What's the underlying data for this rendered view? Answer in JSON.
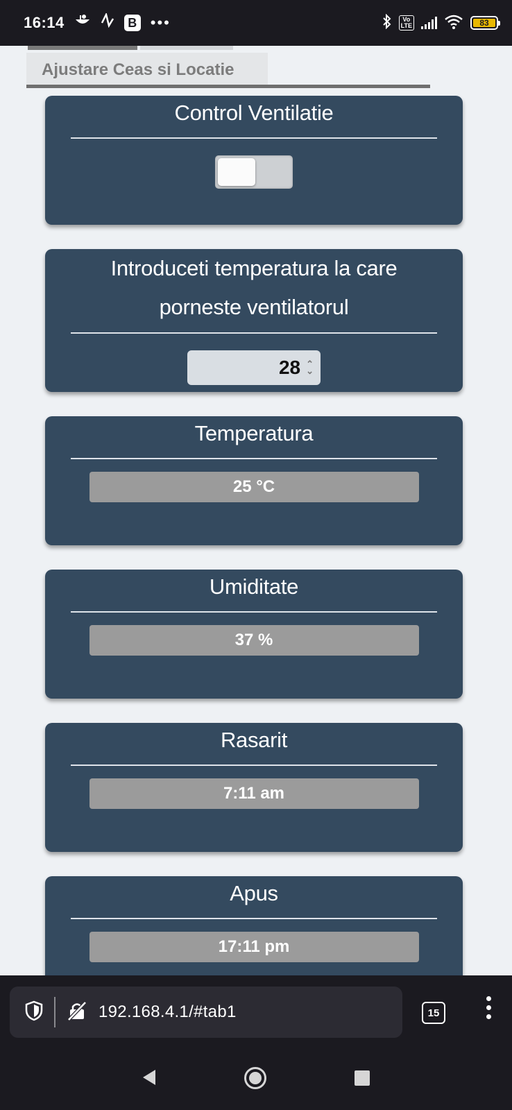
{
  "status_bar": {
    "time": "16:14",
    "battery": "83"
  },
  "tab": {
    "label": "Ajustare Ceas si Locatie"
  },
  "cards": {
    "ventilation": {
      "title": "Control Ventilatie",
      "toggle_state": "off"
    },
    "threshold": {
      "title": "Introduceti temperatura la care porneste ventilatorul",
      "value": "28"
    },
    "temperature": {
      "title": "Temperatura",
      "value": "25 °C"
    },
    "humidity": {
      "title": "Umiditate",
      "value": "37 %"
    },
    "sunrise": {
      "title": "Rasarit",
      "value": "7:11 am"
    },
    "sunset": {
      "title": "Apus",
      "value": "17:11 pm"
    }
  },
  "browser": {
    "url": "192.168.4.1/#tab1",
    "tab_count": "15"
  },
  "colors": {
    "card_bg": "#344a5f",
    "value_bar_bg": "#9b9b9b",
    "battery": "#e8b800"
  }
}
